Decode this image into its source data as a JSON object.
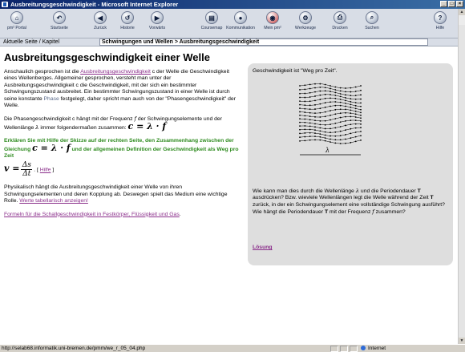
{
  "window": {
    "title": "Ausbreitungsgeschwindigkeit - Microsoft Internet Explorer",
    "controls": [
      "_",
      "□",
      "×"
    ]
  },
  "toolbar": {
    "buttons": [
      {
        "label": "pm² Portal",
        "icon": "home-icon",
        "glyph": "⌂"
      },
      {
        "label": "Startseite",
        "icon": "start-icon",
        "glyph": "↶"
      },
      {
        "label": "Zurück",
        "icon": "back-icon",
        "glyph": "◀"
      },
      {
        "label": "Historie",
        "icon": "history-icon",
        "glyph": "↺"
      },
      {
        "label": "Vorwärts",
        "icon": "forward-icon",
        "glyph": "▶"
      },
      {
        "label": "Coursemap",
        "icon": "coursemap-icon",
        "glyph": "▤"
      },
      {
        "label": "Kommunikation",
        "icon": "chat-icon",
        "glyph": "💬"
      },
      {
        "label": "Mein pm²",
        "icon": "mypm-icon",
        "glyph": "◉"
      },
      {
        "label": "Werkzeuge",
        "icon": "tools-icon",
        "glyph": "⚙"
      },
      {
        "label": "Drucken",
        "icon": "print-icon",
        "glyph": "⎙"
      },
      {
        "label": "Suchen",
        "icon": "search-icon",
        "glyph": "⌕"
      },
      {
        "label": "Hilfe",
        "icon": "help-icon",
        "glyph": "?"
      }
    ]
  },
  "breadcrumb": {
    "label": "Aktuelle Seite / Kapitel",
    "path": "Schwingungen und Wellen > Ausbreitungsgeschwindigkeit"
  },
  "content": {
    "title": "Ausbreitungsgeschwindigkeit einer Welle",
    "p1_before": "Anschaulich gesprochen ist die ",
    "p1_link": "Ausbreitungsgeschwindigkeit",
    "p1_after": " c der Welle die Geschwindigkeit eines Wellenberges. Allgemeiner gesprochen, versteht man unter der Ausbreitungsgeschwindigkeit c die Geschwindigkeit, mit der sich ein bestimmter Schwingungszustand ausbreitet. Ein bestimmter Schwingungszustand in einer Welle ist durch seine konstante ",
    "p1_phase": "Phase",
    "p1_end": " festgelegt, daher spricht man auch von der \"Phasengeschwindigkeit\" der Welle.",
    "p2_a": "Die Phasengeschwindigkeit c hängt mit der Frequenz ",
    "p2_f": "f",
    "p2_b": " der Schwingungselemente und der Wellenlänge ",
    "p2_lambda": "λ",
    "p2_c": " immer folgendermaßen zusammen: ",
    "formula_main": "c = λ · f",
    "task": "Erklären Sie mit Hilfe der Skizze auf der rechten Seite, den Zusammenhang zwischen der Gleichung ",
    "task_formula": "c = λ · f",
    "task_end": " und der allgemeinen Definition der Geschwindigkeit als Weg pro Zeit",
    "v_lhs": "v =",
    "v_num": "Δs",
    "v_den": "Δt",
    "hilfe_open": ". [ ",
    "hilfe_link": "Hilfe",
    "hilfe_close": " ]",
    "p3": "Physikalisch hängt die Ausbreitungsgeschwindigkeit einer Welle von ihren Schwingungselementen und deren Kopplung ab. Deswegen spielt das Medium eine wichtige Rolle. ",
    "p3_link": "Werte tabellarisch anzeigen!",
    "p4_link": "Formeln für die Schallgeschwindigkeit in Festkörper, Flüssigkeit und Gas",
    "p4_end": "."
  },
  "sidebar": {
    "heading": "Geschwindigkeit ist \"Weg pro Zeit\".",
    "diagram_label": "λ",
    "q1": "Wie kann man dies durch die Wellenlänge ",
    "q_lambda": "λ",
    "q2": " und die Periodendauer ",
    "q_T": "T",
    "q3": " ausdrücken? Bzw. wieviele Wellenlängen legt die Welle während der Zeit ",
    "q_T2": "T",
    "q4": " zurück, in der ein Schwingungselement eine vollständige Schwingung ausführt? Wie hängt die Periodendauer ",
    "q_T3": "T",
    "q5": " mit der Frequenz ",
    "q_f": "f",
    "q6": " zusammen?",
    "loesung": "Lösung"
  },
  "status": {
    "url": "http://selab68.informatik.uni-bremen.de/pmm/we_r_05_04.php",
    "zone": "Internet"
  }
}
